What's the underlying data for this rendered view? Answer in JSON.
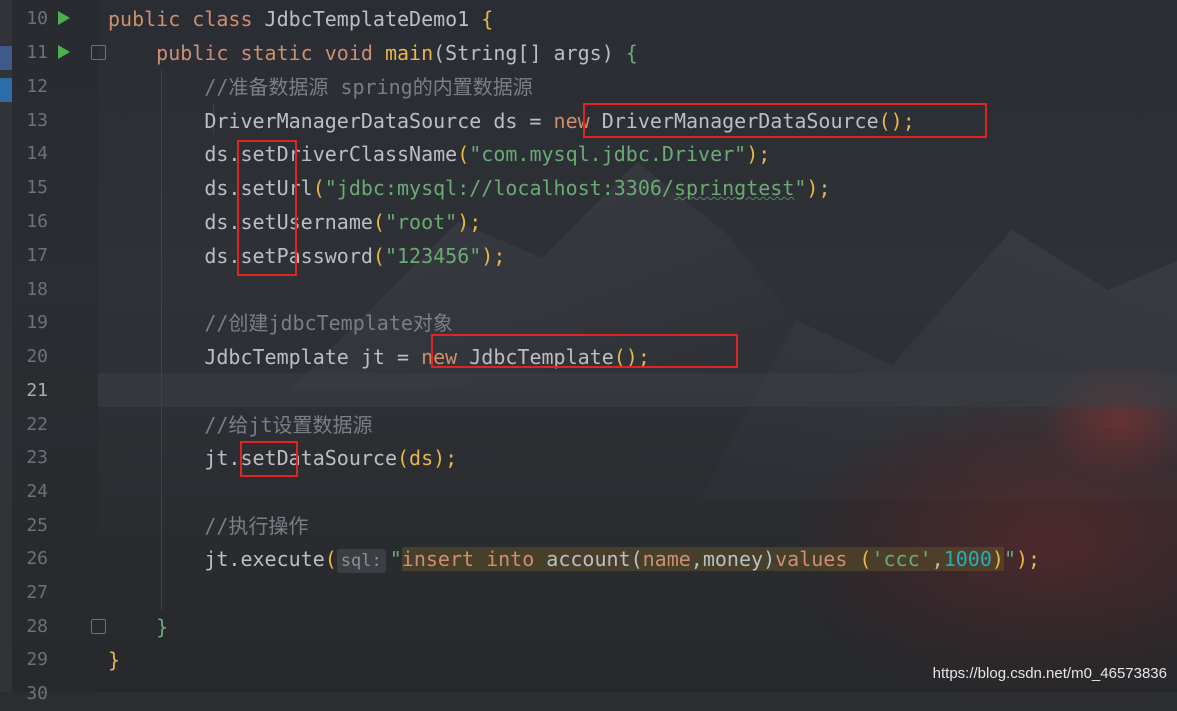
{
  "editor": {
    "line_numbers": [
      "10",
      "11",
      "12",
      "13",
      "14",
      "15",
      "16",
      "17",
      "18",
      "19",
      "20",
      "21",
      "22",
      "23",
      "24",
      "25",
      "26",
      "27",
      "28",
      "29",
      "30"
    ],
    "current_line": "21",
    "colors": {
      "keyword": "#cf8e6d",
      "string": "#6aab73",
      "comment": "#7a7e85",
      "method": "#e8b64a",
      "number": "#2aacb8",
      "annotation_box": "#e02424",
      "run_icon": "#4caf50"
    }
  },
  "code": {
    "l10": {
      "kw1": "public class",
      "name": " JdbcTemplateDemo1 ",
      "brace": "{"
    },
    "l11": {
      "indent": "    ",
      "kw1": "public static void",
      "method": " main",
      "args": "(String[] args) ",
      "brace": "{"
    },
    "l12": {
      "indent": "        ",
      "comment": "//准备数据源 spring的内置数据源"
    },
    "l13": {
      "indent": "        ",
      "decl": "DriverManagerDataSource ds = ",
      "kw_new": "new",
      "ctor": " DriverManagerDataSource",
      "tail": "();"
    },
    "l14": {
      "indent": "        ",
      "obj": "ds.",
      "method": "setDriverClassName",
      "open": "(",
      "str": "\"com.mysql.jdbc.Driver\"",
      "close": ");"
    },
    "l15": {
      "indent": "        ",
      "obj": "ds.",
      "method": "setUrl",
      "open": "(",
      "str1": "\"jdbc:mysql://localhost:3306/",
      "str2": "springtest",
      "str3": "\"",
      "close": ");"
    },
    "l16": {
      "indent": "        ",
      "obj": "ds.",
      "method": "setUsername",
      "open": "(",
      "str": "\"root\"",
      "close": ");"
    },
    "l17": {
      "indent": "        ",
      "obj": "ds.",
      "method": "setPassword",
      "open": "(",
      "str": "\"123456\"",
      "close": ");"
    },
    "l19": {
      "indent": "        ",
      "comment": "//创建jdbcTemplate对象"
    },
    "l20": {
      "indent": "        ",
      "decl": "JdbcTemplate jt = ",
      "kw_new": "new",
      "ctor": " JdbcTemplate",
      "tail": "();"
    },
    "l22": {
      "indent": "        ",
      "comment": "//给jt设置数据源"
    },
    "l23": {
      "indent": "        ",
      "obj": "jt.",
      "method": "setDataSource",
      "args": "(ds);"
    },
    "l25": {
      "indent": "        ",
      "comment": "//执行操作"
    },
    "l26": {
      "indent": "        ",
      "obj": "jt.",
      "method": "execute",
      "open": "(",
      "hint": "sql:",
      "q1": "\"",
      "sql_kw1": "insert into",
      "sql_tbl": " account(",
      "sql_c1": "name",
      "sql_comma": ",",
      "sql_c2": "money",
      "sql_close": ")",
      "sql_kw2": "values ",
      "sql_open": "(",
      "sql_s": "'ccc'",
      "sql_comma2": ",",
      "sql_n": "1000",
      "sql_close2": ")",
      "q2": "\"",
      "close": ");"
    },
    "l28": {
      "indent": "    ",
      "brace": "}"
    },
    "l29": {
      "brace": "}"
    }
  },
  "watermark": "https://blog.csdn.net/m0_46573836"
}
